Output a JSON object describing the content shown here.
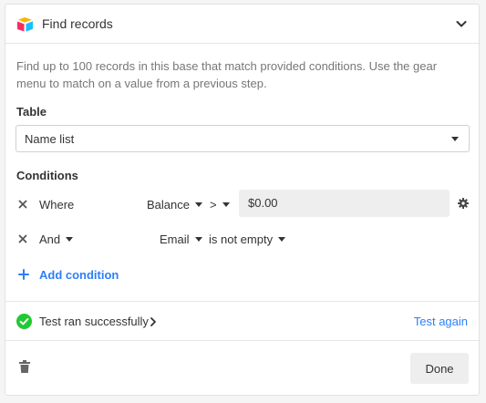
{
  "header": {
    "title": "Find records",
    "logo_icon": "airtable-logo-icon",
    "collapse_icon": "chevron-down-icon"
  },
  "description": "Find up to 100 records in this base that match provided conditions. Use the gear menu to match on a value from a previous step.",
  "table": {
    "label": "Table",
    "selected": "Name list"
  },
  "conditions": {
    "label": "Conditions",
    "rows": [
      {
        "connector": "Where",
        "field": "Balance",
        "operator": ">",
        "value": "$0.00"
      },
      {
        "connector": "And",
        "field": "Email",
        "operator": "is not empty",
        "value": ""
      }
    ],
    "add_label": "Add condition"
  },
  "test": {
    "status": "Test ran successfully",
    "again_label": "Test again"
  },
  "footer": {
    "done_label": "Done"
  },
  "colors": {
    "accent": "#2d7ff9",
    "success": "#20c933",
    "logo_yellow": "#fcb400",
    "logo_red": "#f82b60",
    "logo_blue": "#18bfff"
  }
}
